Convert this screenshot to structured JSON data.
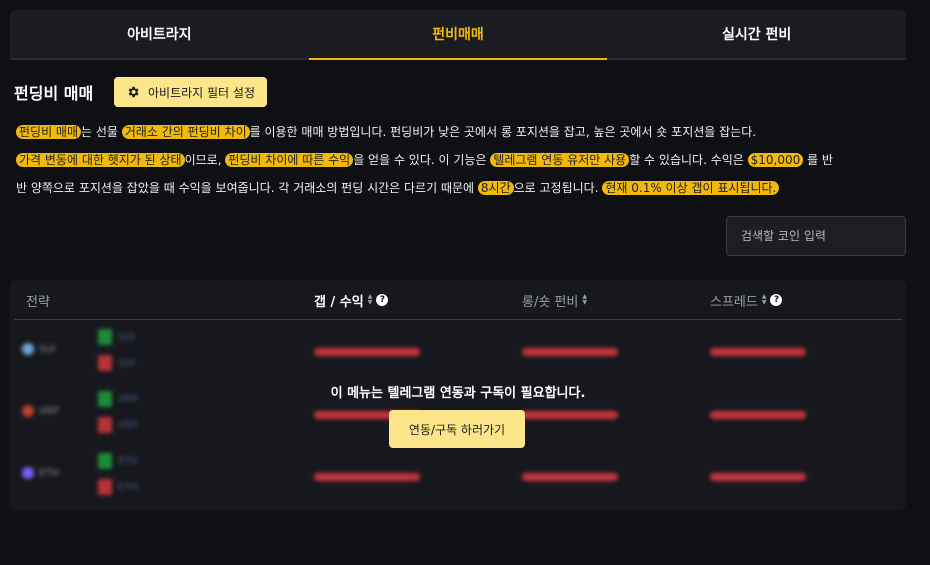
{
  "tabs": [
    {
      "label": "아비트라지"
    },
    {
      "label": "펀비매매"
    },
    {
      "label": "실시간 펀비"
    }
  ],
  "section": {
    "title": "펀딩비 매매",
    "filter_button": "아비트라지 필터 설정"
  },
  "description": {
    "l1_hl1": "펀딩비 매매",
    "l1_t1": "는 선물 ",
    "l1_hl2": "거래소 간의 펀딩비 차이",
    "l1_t2": "를 이용한 매매 방법입니다. 펀딩비가 낮은 곳에서 롱 포지션을 잡고, 높은 곳에서 숏 포지션을 잡는다.",
    "l2_hl1": "가격 변동에 대한 헷지가 된 상태",
    "l2_t1": "이므로, ",
    "l2_hl2": "펀딩비 차이에 따른 수익",
    "l2_t2": "을 얻을 수 있다. 이 기능은 ",
    "l2_hl3": "텔레그램 연동 유저만 사용",
    "l2_t3": "할 수 있습니다. 수익은 ",
    "l2_hl4": "$10,000",
    "l2_t4": " 를 반",
    "l3_t1": "반 양쪽으로 포지션을 잡았을 때 수익을 보여줍니다. 각 거래소의 펀딩 시간은 다르기 때문에 ",
    "l3_hl1": "8시간",
    "l3_t2": "으로 고정됩니다. ",
    "l3_hl2": "현재 0.1% 이상 갭이 표시됩니다."
  },
  "search": {
    "placeholder": "검색할 코인 입력"
  },
  "table": {
    "headers": {
      "strategy": "전략",
      "gap_profit": "갭 / 수익",
      "long_short_funding": "롱/숏 펀비",
      "spread": "스프레드"
    },
    "rows": [
      {
        "coin": "SUI",
        "color": "#6fa8dc"
      },
      {
        "coin": "XRP",
        "color": "#c0442a"
      },
      {
        "coin": "ETH",
        "color": "#7b61ff"
      }
    ]
  },
  "overlay": {
    "message": "이 메뉴는 텔레그램 연동과 구독이 필요합니다.",
    "button": "연동/구독 하러가기"
  },
  "colors": {
    "accent": "#f0b90b",
    "button_bg": "#fde68a",
    "bar_red": "#c6353b"
  }
}
